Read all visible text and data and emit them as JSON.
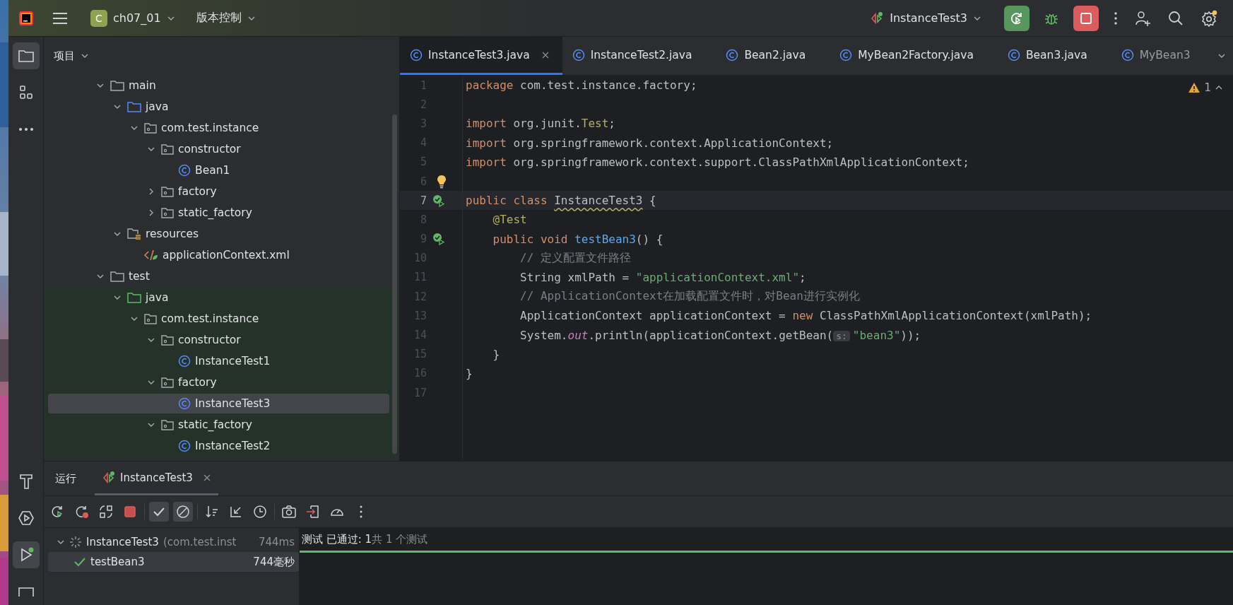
{
  "top_bar": {
    "project": {
      "badge": "C",
      "name": "ch07_01"
    },
    "vcs_menu": "版本控制",
    "run_config": "InstanceTest3"
  },
  "left_toolbar": {
    "top": [
      {
        "kind": "project",
        "selected": true
      },
      {
        "kind": "structure",
        "selected": false
      },
      {
        "kind": "more",
        "selected": false
      }
    ],
    "bottom": [
      {
        "kind": "build",
        "selected": false
      },
      {
        "kind": "services",
        "selected": false
      },
      {
        "kind": "run",
        "selected": true
      },
      {
        "kind": "terminal",
        "selected": false
      }
    ]
  },
  "project_panel": {
    "title": "项目",
    "tree": [
      {
        "label": "main",
        "kind": "folder",
        "expanded": true,
        "selected": false,
        "children": [
          {
            "label": "java",
            "kind": "source-folder",
            "expanded": true,
            "selected": false,
            "children": [
              {
                "label": "com.test.instance",
                "kind": "package",
                "expanded": true,
                "selected": false,
                "children": [
                  {
                    "label": "constructor",
                    "kind": "package",
                    "expanded": true,
                    "selected": false,
                    "children": [
                      {
                        "label": "Bean1",
                        "kind": "class",
                        "selected": false
                      }
                    ]
                  },
                  {
                    "label": "factory",
                    "kind": "package",
                    "expanded": false,
                    "selected": false
                  },
                  {
                    "label": "static_factory",
                    "kind": "package",
                    "expanded": false,
                    "selected": false
                  }
                ]
              }
            ]
          },
          {
            "label": "resources",
            "kind": "resources-folder",
            "expanded": true,
            "selected": false,
            "children": [
              {
                "label": "applicationContext.xml",
                "kind": "xml",
                "selected": false
              }
            ]
          }
        ]
      },
      {
        "label": "test",
        "kind": "folder",
        "expanded": true,
        "selected": false,
        "children": [
          {
            "label": "java",
            "kind": "test-source-folder",
            "expanded": true,
            "selected": false,
            "children": [
              {
                "label": "com.test.instance",
                "kind": "package",
                "expanded": true,
                "selected": false,
                "children": [
                  {
                    "label": "constructor",
                    "kind": "package",
                    "expanded": true,
                    "selected": false,
                    "children": [
                      {
                        "label": "InstanceTest1",
                        "kind": "class",
                        "selected": false
                      }
                    ]
                  },
                  {
                    "label": "factory",
                    "kind": "package",
                    "expanded": true,
                    "selected": false,
                    "children": [
                      {
                        "label": "InstanceTest3",
                        "kind": "class",
                        "selected": true
                      }
                    ]
                  },
                  {
                    "label": "static_factory",
                    "kind": "package",
                    "expanded": true,
                    "selected": false,
                    "children": [
                      {
                        "label": "InstanceTest2",
                        "kind": "class",
                        "selected": false
                      }
                    ]
                  }
                ]
              }
            ]
          }
        ]
      }
    ]
  },
  "editor": {
    "tabs": [
      {
        "label": "InstanceTest3.java",
        "selected": true
      },
      {
        "label": "InstanceTest2.java",
        "selected": false
      },
      {
        "label": "Bean2.java",
        "selected": false
      },
      {
        "label": "MyBean2Factory.java",
        "selected": false
      },
      {
        "label": "Bean3.java",
        "selected": false
      },
      {
        "label": "MyBean3",
        "selected": false
      }
    ],
    "warnings": "1",
    "lines": [
      {
        "number": "1",
        "current": false,
        "test_marker": false,
        "bulb": false,
        "tokens": [
          {
            "kind": "kw",
            "text": "package "
          },
          {
            "kind": "plain",
            "text": "com.test.instance.factory;"
          }
        ]
      },
      {
        "number": "2",
        "current": false,
        "test_marker": false,
        "bulb": false
      },
      {
        "number": "3",
        "current": false,
        "test_marker": false,
        "bulb": false,
        "tokens": [
          {
            "kind": "kw",
            "text": "import "
          },
          {
            "kind": "plain",
            "text": "org.junit."
          },
          {
            "kind": "annot",
            "text": "Test"
          },
          {
            "kind": "plain",
            "text": ";"
          }
        ]
      },
      {
        "number": "4",
        "current": false,
        "test_marker": false,
        "bulb": false,
        "tokens": [
          {
            "kind": "kw",
            "text": "import "
          },
          {
            "kind": "plain",
            "text": "org.springframework.context.ApplicationContext;"
          }
        ]
      },
      {
        "number": "5",
        "current": false,
        "test_marker": false,
        "bulb": false,
        "tokens": [
          {
            "kind": "kw",
            "text": "import "
          },
          {
            "kind": "plain",
            "text": "org.springframework.context.support.ClassPathXmlApplicationContext;"
          }
        ]
      },
      {
        "number": "6",
        "current": false,
        "test_marker": false,
        "bulb": true
      },
      {
        "number": "7",
        "current": true,
        "test_marker": true,
        "bulb": false,
        "tokens": [
          {
            "kind": "kw",
            "text": "public class "
          },
          {
            "kind": "warn",
            "text": "InstanceTest3"
          },
          {
            "kind": "plain",
            "text": " {"
          }
        ]
      },
      {
        "number": "8",
        "current": false,
        "test_marker": false,
        "bulb": false,
        "tokens": [
          {
            "kind": "annot",
            "text": "    @Test"
          }
        ]
      },
      {
        "number": "9",
        "current": false,
        "test_marker": true,
        "bulb": false,
        "tokens": [
          {
            "kind": "kw",
            "text": "    public void "
          },
          {
            "kind": "fn",
            "text": "testBean3"
          },
          {
            "kind": "plain",
            "text": "() {"
          }
        ]
      },
      {
        "number": "10",
        "current": false,
        "test_marker": false,
        "bulb": false,
        "tokens": [
          {
            "kind": "comment",
            "text": "        // 定义配置文件路径"
          }
        ]
      },
      {
        "number": "11",
        "current": false,
        "test_marker": false,
        "bulb": false,
        "tokens": [
          {
            "kind": "plain",
            "text": "        String xmlPath = "
          },
          {
            "kind": "str",
            "text": "\"applicationContext.xml\""
          },
          {
            "kind": "plain",
            "text": ";"
          }
        ]
      },
      {
        "number": "12",
        "current": false,
        "test_marker": false,
        "bulb": false,
        "tokens": [
          {
            "kind": "comment",
            "text": "        // ApplicationContext在加载配置文件时，对Bean进行实例化"
          }
        ]
      },
      {
        "number": "13",
        "current": false,
        "test_marker": false,
        "bulb": false,
        "tokens": [
          {
            "kind": "plain",
            "text": "        ApplicationContext applicationContext = "
          },
          {
            "kind": "kw",
            "text": "new "
          },
          {
            "kind": "plain",
            "text": "ClassPathXmlApplicationContext(xmlPath);"
          }
        ]
      },
      {
        "number": "14",
        "current": false,
        "test_marker": false,
        "bulb": false,
        "tokens": [
          {
            "kind": "plain",
            "text": "        System."
          },
          {
            "kind": "static",
            "text": "out"
          },
          {
            "kind": "plain",
            "text": ".println(applicationContext.getBean("
          },
          {
            "kind": "hint",
            "text": "s:"
          },
          {
            "kind": "str",
            "text": "\"bean3\""
          },
          {
            "kind": "plain",
            "text": "));"
          }
        ]
      },
      {
        "number": "15",
        "current": false,
        "test_marker": false,
        "bulb": false,
        "tokens": [
          {
            "kind": "plain",
            "text": "    }"
          }
        ]
      },
      {
        "number": "16",
        "current": false,
        "test_marker": false,
        "bulb": false,
        "tokens": [
          {
            "kind": "plain",
            "text": "}"
          }
        ]
      },
      {
        "number": "17",
        "current": false,
        "test_marker": false,
        "bulb": false
      }
    ]
  },
  "run_panel": {
    "title": "运行",
    "tabs": [
      {
        "label": "InstanceTest3",
        "selected": true
      }
    ],
    "toolbar": [
      {
        "kind": "rerun"
      },
      {
        "kind": "rerun-failed"
      },
      {
        "kind": "toggle-auto"
      },
      {
        "kind": "stop"
      },
      {
        "kind": "sep"
      },
      {
        "kind": "show-passed",
        "on": true
      },
      {
        "kind": "show-ignored",
        "on": true
      },
      {
        "kind": "sep"
      },
      {
        "kind": "sort"
      },
      {
        "kind": "collapse"
      },
      {
        "kind": "history"
      },
      {
        "kind": "sep"
      },
      {
        "kind": "screenshot"
      },
      {
        "kind": "export"
      },
      {
        "kind": "gauge"
      },
      {
        "kind": "more"
      }
    ],
    "tests": [
      {
        "name": "InstanceTest3",
        "detail": "(com.test.inst",
        "time": "744ms",
        "passed": false,
        "expanded": true,
        "selected": false,
        "children": [
          {
            "name": "testBean3",
            "time": "744毫秒",
            "passed": true,
            "selected": true
          }
        ]
      }
    ],
    "status": "测试 已通过: 1",
    "summary": "共 1 个测试",
    "progress": {
      "level": 1
    }
  }
}
